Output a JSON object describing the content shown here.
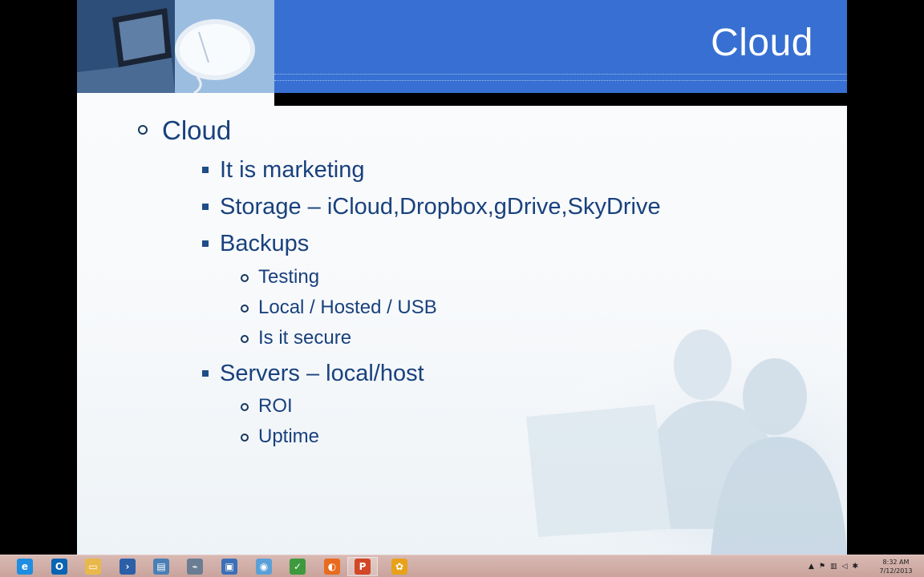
{
  "slide": {
    "title": "Cloud",
    "bullets": [
      {
        "level": 1,
        "text": "Cloud"
      },
      {
        "level": 2,
        "text": "It is marketing"
      },
      {
        "level": 2,
        "text": "Storage – iCloud,Dropbox,gDrive,SkyDrive"
      },
      {
        "level": 2,
        "text": "Backups"
      },
      {
        "level": 3,
        "text": "Testing"
      },
      {
        "level": 3,
        "text": "Local / Hosted / USB"
      },
      {
        "level": 3,
        "text": "Is it secure"
      },
      {
        "level": 2,
        "text": "Servers – local/host"
      },
      {
        "level": 3,
        "text": "ROI"
      },
      {
        "level": 3,
        "text": "Uptime"
      }
    ]
  },
  "taskbar": {
    "apps": [
      {
        "name": "internet-explorer",
        "glyph": "e",
        "color": "#1f8ee0"
      },
      {
        "name": "outlook",
        "glyph": "O",
        "color": "#0a64b4"
      },
      {
        "name": "file-explorer",
        "glyph": "▭",
        "color": "#e8b84a"
      },
      {
        "name": "powershell",
        "glyph": "›",
        "color": "#2b5fa8"
      },
      {
        "name": "server-manager",
        "glyph": "▤",
        "color": "#4a7fb5"
      },
      {
        "name": "network-tool",
        "glyph": "⌁",
        "color": "#6a7d92"
      },
      {
        "name": "remote-desktop",
        "glyph": "▣",
        "color": "#3b6fb6"
      },
      {
        "name": "lync",
        "glyph": "◉",
        "color": "#5aa0d8"
      },
      {
        "name": "excel-tool",
        "glyph": "✓",
        "color": "#3d9a3d"
      },
      {
        "name": "firefox",
        "glyph": "◐",
        "color": "#e86b1f"
      },
      {
        "name": "powerpoint",
        "glyph": "P",
        "color": "#d24726"
      },
      {
        "name": "flower-app",
        "glyph": "✿",
        "color": "#e8a21a"
      }
    ],
    "active_app": "powerpoint",
    "tray_icons": [
      "show-hidden-icons",
      "flag-icon",
      "network-icon",
      "volume-icon",
      "security-icon"
    ],
    "time": "8:32 AM",
    "date": "7/12/2013"
  }
}
